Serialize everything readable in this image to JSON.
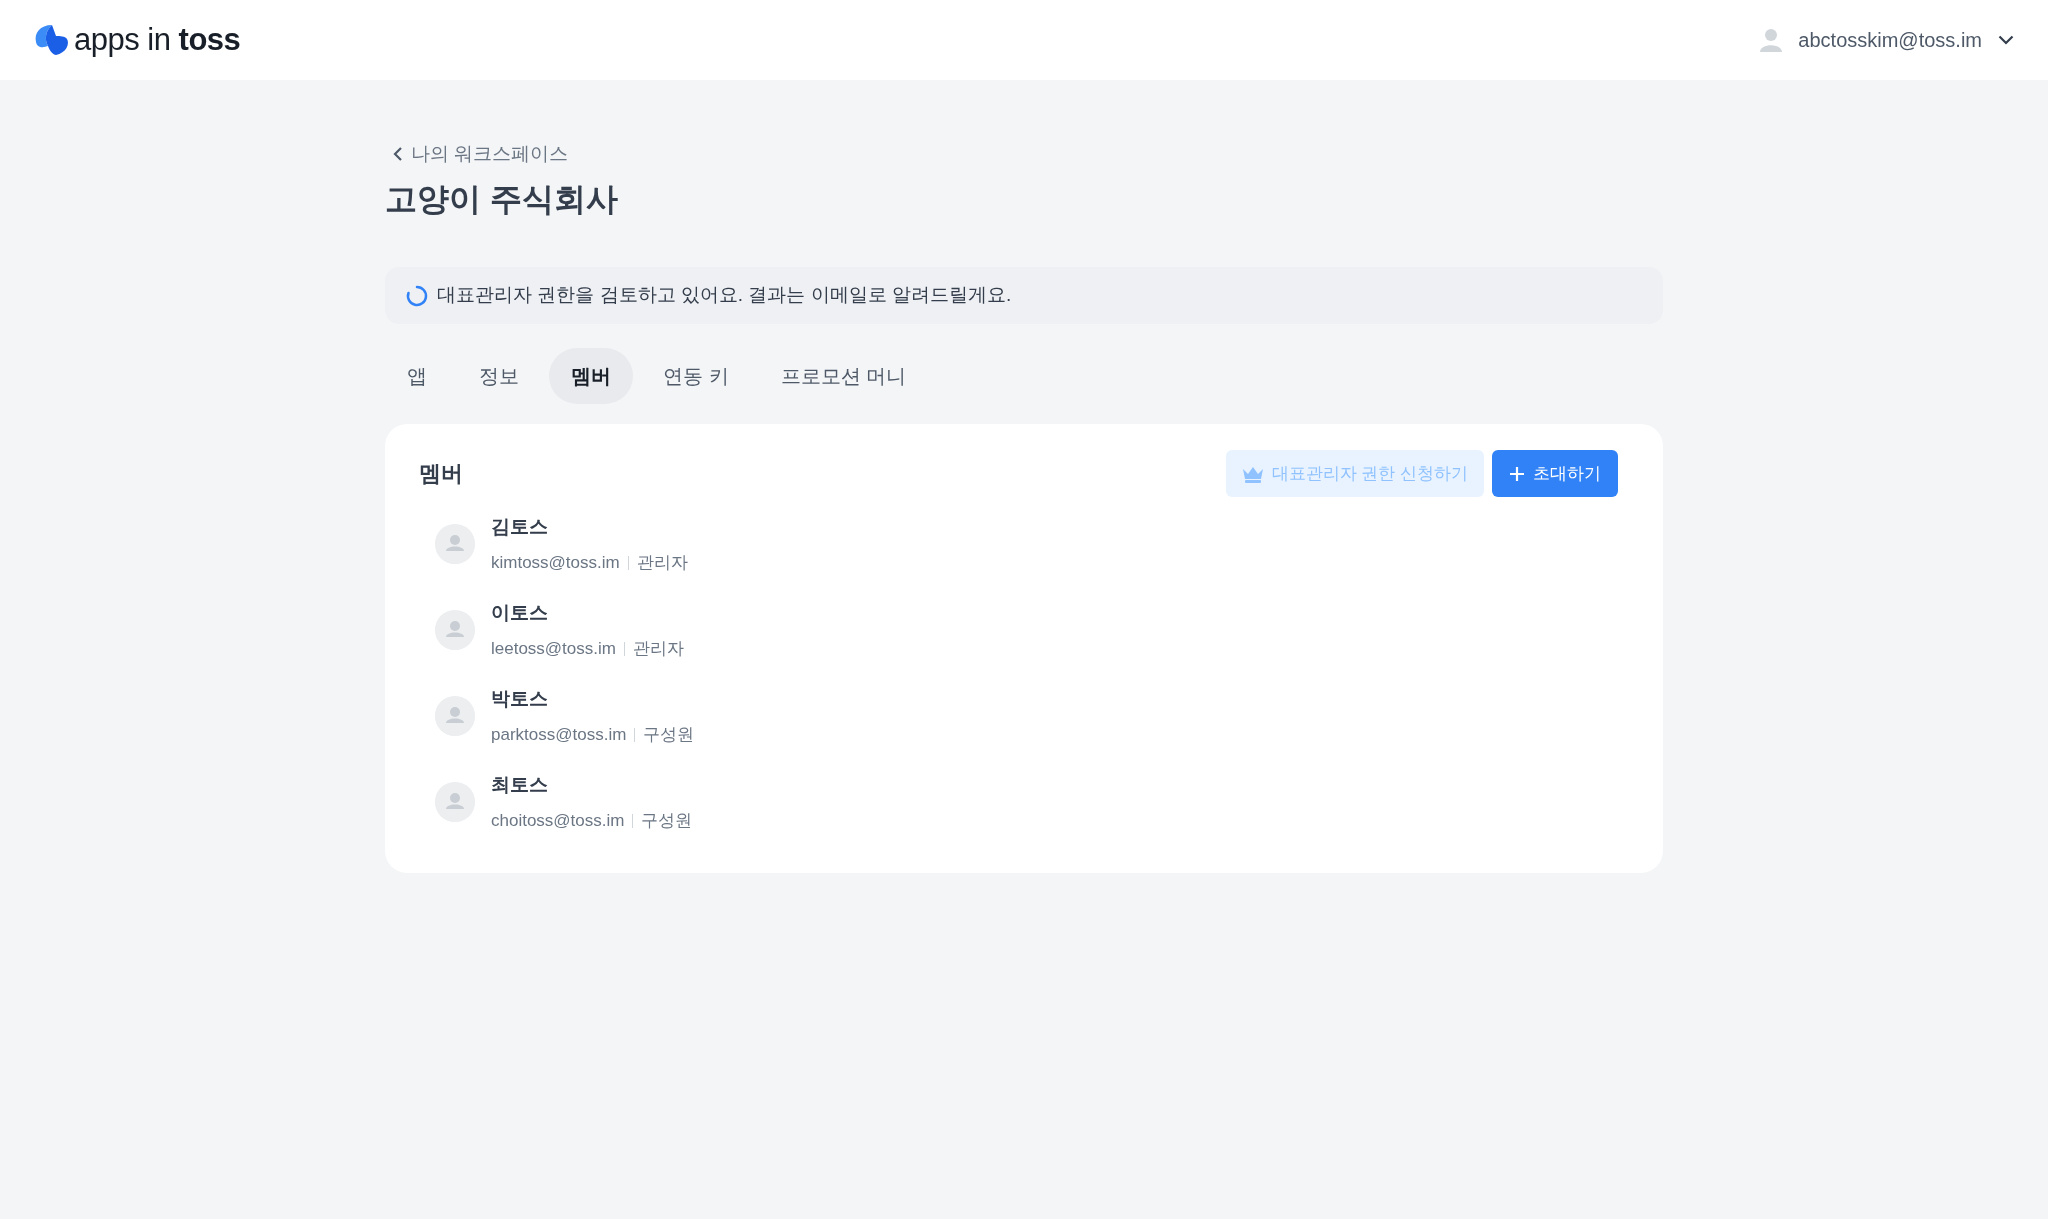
{
  "header": {
    "logo": "apps in **toss**",
    "user_email": "abctosskim@toss.im"
  },
  "back_link": "나의 워크스페이스",
  "title": "고양이 주식회사",
  "notice": "대표관리자 권한을 검토하고 있어요. 결과는 이메일로 알려드릴게요.",
  "tabs": [
    {
      "label": "앱",
      "selected": false
    },
    {
      "label": "정보",
      "selected": false
    },
    {
      "label": "멤버",
      "selected": true
    },
    {
      "label": "연동 키",
      "selected": false
    },
    {
      "label": "프로모션 머니",
      "selected": false
    }
  ],
  "members_card": {
    "title": "멤버",
    "request_button": {
      "label": "대표관리자 권한 신청하기",
      "disabled": true
    },
    "invite_button": "초대하기",
    "members": [
      {
        "name": "김토스",
        "email": "kimtoss@toss.im",
        "role": "관리자"
      },
      {
        "name": "이토스",
        "email": "leetoss@toss.im",
        "role": "관리자"
      },
      {
        "name": "박토스",
        "email": "parktoss@toss.im",
        "role": "구성원"
      },
      {
        "name": "최토스",
        "email": "choitoss@toss.im",
        "role": "구성원"
      }
    ]
  }
}
